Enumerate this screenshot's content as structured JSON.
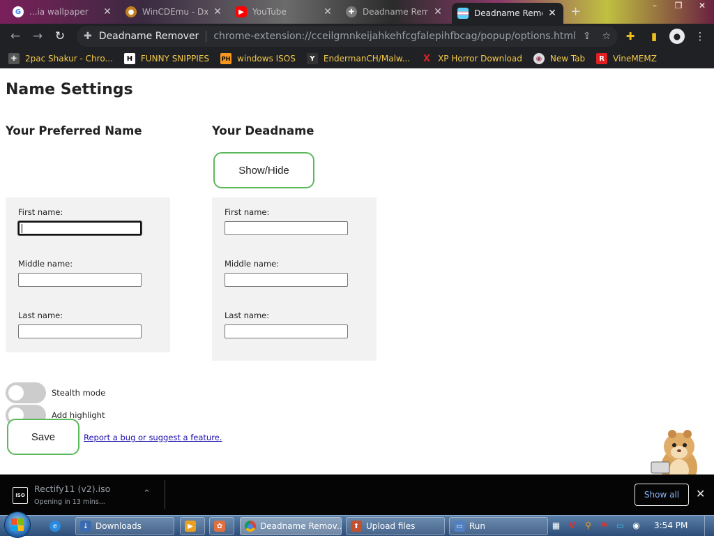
{
  "tabs": [
    {
      "title": "...ia wallpaper",
      "icon": "google-icon",
      "color": "#4285f4",
      "glyph": "G"
    },
    {
      "title": "WinCDEmu - Dx",
      "icon": "wincdemu-icon",
      "color": "#c08020",
      "glyph": "●"
    },
    {
      "title": "YouTube",
      "icon": "youtube-icon",
      "color": "#ff0000",
      "glyph": "▶"
    },
    {
      "title": "Deadname Rem",
      "icon": "puzzle-tab-icon",
      "color": "#7a7a7a",
      "glyph": "✚"
    },
    {
      "title": "Deadname Remo",
      "icon": "trans-flag-icon",
      "color": "#f5a9b8",
      "glyph": ""
    }
  ],
  "window": {
    "minimize": "–",
    "maximize": "❐",
    "close": "✕"
  },
  "omnibox": {
    "ext_name": "Deadname Remover",
    "url": "chrome-extension://cceilgmnkeijahkehfcgfalepihfbcag/popup/options.html"
  },
  "bookmarks": [
    {
      "label": "2pac Shakur - Chro...",
      "icon": "puzzle-bookmark-icon",
      "glyph": "✚",
      "bg": "#555",
      "fg": "#ddd"
    },
    {
      "label": "FUNNY SNIPPIES",
      "icon": "h-bookmark-icon",
      "glyph": "H",
      "bg": "#fff",
      "fg": "#000"
    },
    {
      "label": "windows ISOS",
      "icon": "ph-bookmark-icon",
      "glyph": "PH",
      "bg": "#f7971d",
      "fg": "#000"
    },
    {
      "label": "EndermanCH/Malw...",
      "icon": "yp-bookmark-icon",
      "glyph": "Y",
      "bg": "#333",
      "fg": "#fff"
    },
    {
      "label": "XP Horror Download",
      "icon": "x-bookmark-icon",
      "glyph": "X",
      "bg": "transparent",
      "fg": "#e02020"
    },
    {
      "label": "New Tab",
      "icon": "globe-bookmark-icon",
      "glyph": "◉",
      "bg": "#ddd",
      "fg": "#a04060"
    },
    {
      "label": "VineMEMZ",
      "icon": "r-bookmark-icon",
      "glyph": "R",
      "bg": "#e02020",
      "fg": "#fff"
    }
  ],
  "page": {
    "title": "Name Settings",
    "preferred_heading": "Your Preferred Name",
    "deadname_heading": "Your Deadname",
    "show_hide_label": "Show/Hide",
    "preferred": {
      "first_label": "First name:",
      "middle_label": "Middle name:",
      "last_label": "Last name:",
      "first_value": "",
      "middle_value": "",
      "last_value": ""
    },
    "deadname": {
      "first_label": "First name:",
      "middle_label": "Middle name:",
      "last_label": "Last name:",
      "first_value": "",
      "middle_value": "",
      "last_value": ""
    },
    "stealth_label": "Stealth mode",
    "highlight_label": "Add highlight",
    "stealth_on": false,
    "highlight_on": false,
    "save_label": "Save",
    "report_link": "Report a bug or suggest a feature."
  },
  "download": {
    "filename": "Rectify11 (v2).iso",
    "status": "Opening in 13 mins...",
    "file_icon_text": "ISO",
    "show_all": "Show all"
  },
  "taskbar": {
    "items": [
      {
        "label": "",
        "icon": "ie-icon",
        "glyph": "e",
        "bg": "#2a8ae0"
      },
      {
        "label": "Downloads",
        "icon": "downloads-folder-icon",
        "glyph": "↓",
        "bg": "#3a6ab0"
      },
      {
        "label": "",
        "icon": "media-player-icon",
        "glyph": "▶",
        "bg": "#e8a020"
      },
      {
        "label": "",
        "icon": "paint-icon",
        "glyph": "✿",
        "bg": "#e07040"
      },
      {
        "label": "Deadname Remov...",
        "icon": "chrome-icon",
        "glyph": "◉",
        "bg": "#d84030"
      },
      {
        "label": "Upload files",
        "icon": "upload-icon",
        "glyph": "⬆",
        "bg": "#c05030"
      },
      {
        "label": "Run",
        "icon": "run-icon",
        "glyph": "▭",
        "bg": "#5080c0"
      }
    ],
    "clock": "3:54 PM"
  }
}
